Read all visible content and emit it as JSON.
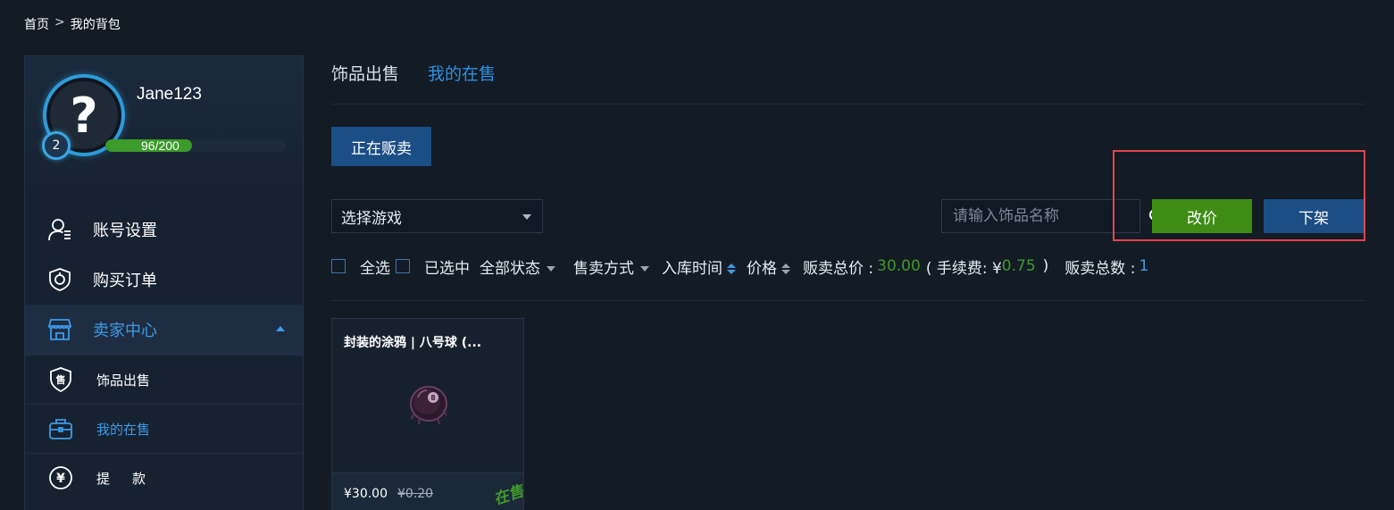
{
  "breadcrumb": {
    "home": "首页",
    "separator": ">",
    "current": "我的背包"
  },
  "profile": {
    "username": "Jane123",
    "avatar_glyph": "?",
    "level": "2",
    "xp_current": "96",
    "xp_max": "/200",
    "xp_progress": 0.48
  },
  "sidebar": {
    "items": [
      {
        "label": "账号设置",
        "icon": "user-settings-icon"
      },
      {
        "label": "购买订单",
        "icon": "shield-order-icon"
      },
      {
        "label": "卖家中心",
        "icon": "store-icon"
      }
    ],
    "sub_items": [
      {
        "label": "饰品出售",
        "icon": "sell-tag-icon"
      },
      {
        "label": "我的在售",
        "icon": "briefcase-icon"
      },
      {
        "label": "提款",
        "label_left": "提",
        "label_right": "款",
        "icon": "yen-circle-icon"
      }
    ]
  },
  "tabs": [
    {
      "label": "饰品出售"
    },
    {
      "label": "我的在售"
    }
  ],
  "toolbar": {
    "selling_button": "正在贩卖",
    "game_select": "选择游戏",
    "search_placeholder": "请输入饰品名称",
    "reprice_button": "改价",
    "delist_button": "下架"
  },
  "filters": {
    "select_all": "全选",
    "selected": "已选中",
    "all_status": "全部状态",
    "sale_method": "售卖方式",
    "stock_time": "入库时间",
    "price": "价格",
    "total_price_label": "贩卖总价 :",
    "total_price_value": "30.00",
    "fee_open": "( 手续费: ¥",
    "fee_value": "0.75",
    "fee_close": ")",
    "total_count_label": "贩卖总数 :",
    "total_count_value": "1"
  },
  "items": [
    {
      "title": "封装的涂鸦 | 八号球 (...",
      "price": "¥30.00",
      "original_price": "¥0.20",
      "status": "在售"
    }
  ],
  "colors": {
    "background": "#131b25",
    "accent_blue": "#1c4e86",
    "link_blue": "#3d9be6",
    "green": "#3f8d14",
    "highlight_red": "#e0454d"
  }
}
